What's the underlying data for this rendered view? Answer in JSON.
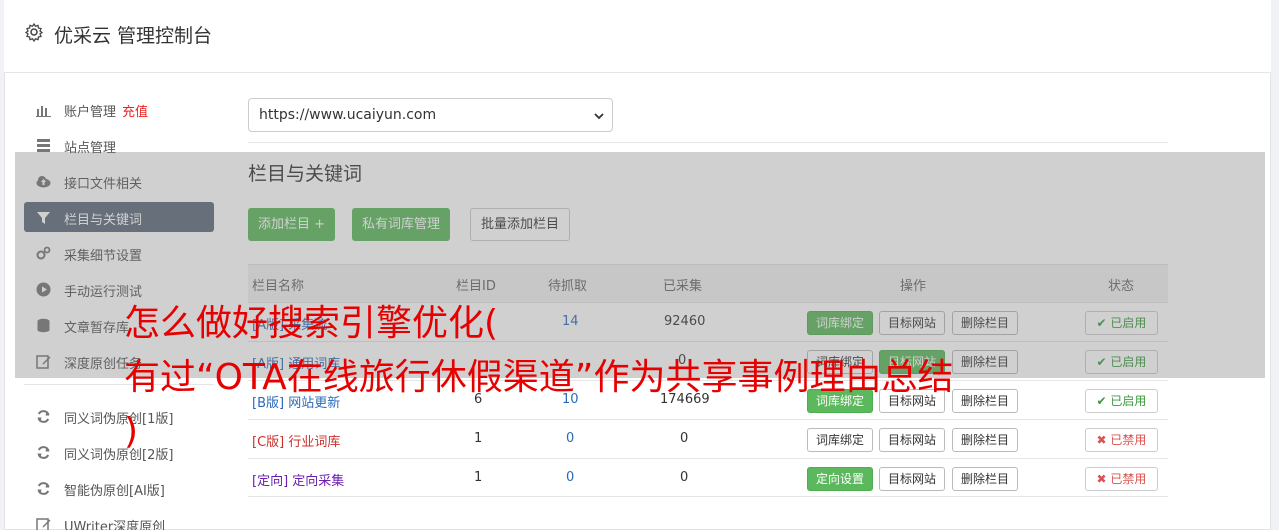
{
  "app": {
    "title": "优采云 管理控制台"
  },
  "sidebar": {
    "items": [
      {
        "label": "账户管理",
        "extra": "充值",
        "icon": "bar-chart-icon"
      },
      {
        "label": "站点管理",
        "icon": "server-icon"
      },
      {
        "label": "接口文件相关",
        "icon": "cloud-upload-icon"
      },
      {
        "label": "栏目与关键词",
        "icon": "filter-icon",
        "active": true
      },
      {
        "label": "采集细节设置",
        "icon": "gears-icon"
      },
      {
        "label": "手动运行测试",
        "icon": "play-circle-icon"
      },
      {
        "label": "文章暂存库",
        "icon": "database-icon"
      },
      {
        "label": "深度原创任务",
        "icon": "edit-icon"
      }
    ],
    "rewrite_items": [
      {
        "label": "同义词伪原创[1版]",
        "icon": "refresh-icon"
      },
      {
        "label": "同义词伪原创[2版]",
        "icon": "refresh-icon"
      },
      {
        "label": "智能伪原创[AI版]",
        "icon": "refresh-icon"
      },
      {
        "label": "UWriter深度原创",
        "icon": "edit-icon"
      }
    ]
  },
  "site_select": {
    "value": "https://www.ucaiyun.com"
  },
  "section": {
    "title": "栏目与关键词"
  },
  "toolbar": {
    "add_column": "添加栏目 +",
    "private_lexicon": "私有词库管理",
    "batch_add": "批量添加栏目"
  },
  "table": {
    "headers": [
      "栏目名称",
      "栏目ID",
      "待抓取",
      "已采集",
      "操作",
      "状态"
    ],
    "rows": [
      {
        "tag": "[A版]",
        "name": "采集流",
        "id": "",
        "pending": "14",
        "collected": "92460",
        "action1": "词库绑定",
        "action2": "目标网站",
        "action3": "删除栏目",
        "status": "已启用"
      },
      {
        "tag": "[A版]",
        "name": "通用词库",
        "id": "",
        "pending": "",
        "collected": "0",
        "action1": "词库绑定",
        "action2": "目标网站",
        "action3": "删除栏目",
        "status": "已启用"
      },
      {
        "tag": "[B版]",
        "name": "网站更新",
        "id": "6",
        "pending": "10",
        "collected": "174669",
        "action1": "词库绑定",
        "action2": "目标网站",
        "action3": "删除栏目",
        "status": "已启用"
      },
      {
        "tag": "[C版]",
        "name": "行业词库",
        "id": "1",
        "pending": "0",
        "collected": "0",
        "action1": "词库绑定",
        "action2": "目标网站",
        "action3": "删除栏目",
        "status": "已禁用"
      },
      {
        "tag": "[定向]",
        "name": "定向采集",
        "id": "1",
        "pending": "0",
        "collected": "0",
        "action1": "定向设置",
        "action2": "目标网站",
        "action3": "删除栏目",
        "status": "已禁用"
      }
    ]
  },
  "headline": {
    "line1": "怎么做好搜索引擎优化(",
    "line2": "有过“OTA在线旅行休假渠道”作为共享事例理由总结",
    "line3": ")"
  },
  "colors": {
    "accent_green": "#5cb85c",
    "active_nav": "#5f6b7c",
    "headline_red": "#e60000"
  }
}
